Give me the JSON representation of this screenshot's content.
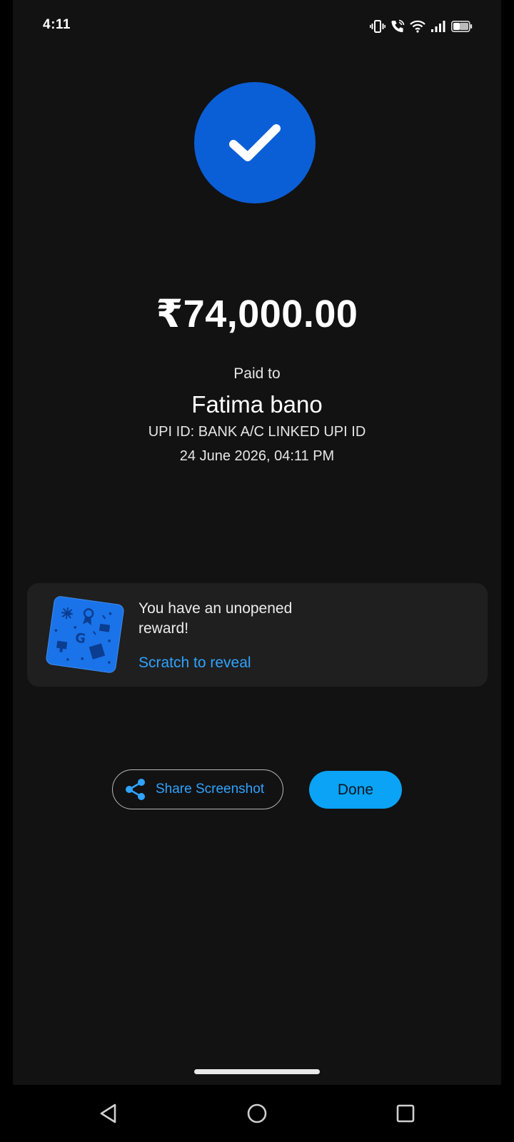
{
  "status_bar": {
    "time": "4:11",
    "icons": [
      "vibrate-icon",
      "wifi-call-icon",
      "wifi-icon",
      "signal-icon",
      "battery-icon"
    ]
  },
  "payment": {
    "amount": "₹74,000.00",
    "paid_to_label": "Paid to",
    "payee_name": "Fatima bano",
    "upi_id": "UPI ID: BANK A/C LINKED UPI ID",
    "datetime": "24 June 2026, 04:11 PM"
  },
  "reward": {
    "message": "You have an unopened reward!",
    "action_label": "Scratch to reveal"
  },
  "actions": {
    "share_label": "Share Screenshot",
    "done_label": "Done"
  },
  "colors": {
    "background": "#121212",
    "check_circle": "#0b5fd6",
    "card": "#1f1f1f",
    "link": "#2fa3ff",
    "done_button": "#0aa3f5"
  },
  "navigation": {
    "buttons": [
      "back-icon",
      "home-icon",
      "recents-icon"
    ]
  }
}
